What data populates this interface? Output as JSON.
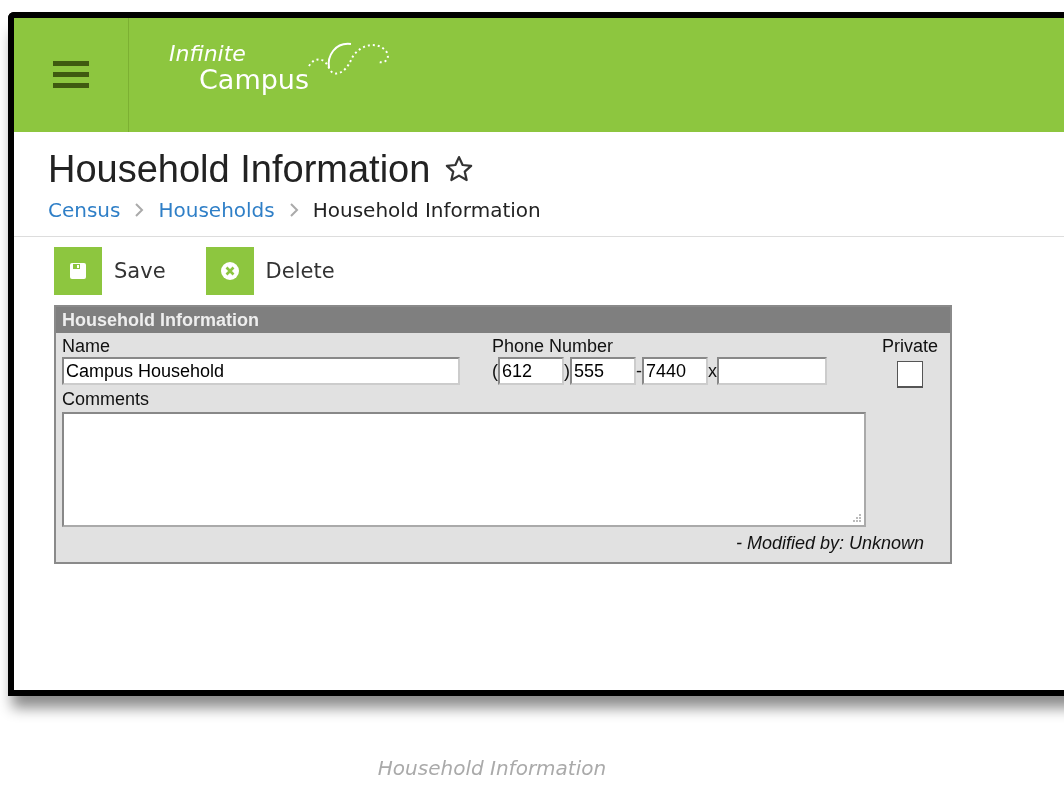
{
  "header": {
    "logo": {
      "line_1": "Infinite",
      "line_2": "Campus"
    }
  },
  "page": {
    "title": "Household Information",
    "favorite": false,
    "breadcrumbs": [
      {
        "label": "Census",
        "kind": "link"
      },
      {
        "label": "Households",
        "kind": "link"
      },
      {
        "label": "Household Information",
        "kind": "current"
      }
    ]
  },
  "toolbar": [
    {
      "label": "Save",
      "kind": "save"
    },
    {
      "label": "Delete",
      "kind": "delete"
    }
  ],
  "panel": {
    "title": "Household Information",
    "name": {
      "label": "Name",
      "value": "Campus Household"
    },
    "phone": {
      "label": "Phone Number",
      "parts": [
        {
          "prefix": "(",
          "value": "612"
        },
        {
          "prefix": ")",
          "value": "555"
        },
        {
          "prefix": "-",
          "value": "7440"
        },
        {
          "prefix": "x"
        }
      ]
    },
    "private": {
      "label": "Private",
      "checked": false
    },
    "comments": {
      "label": "Comments"
    },
    "modified": "- Modified by: Unknown"
  },
  "caption": "Household Information"
}
